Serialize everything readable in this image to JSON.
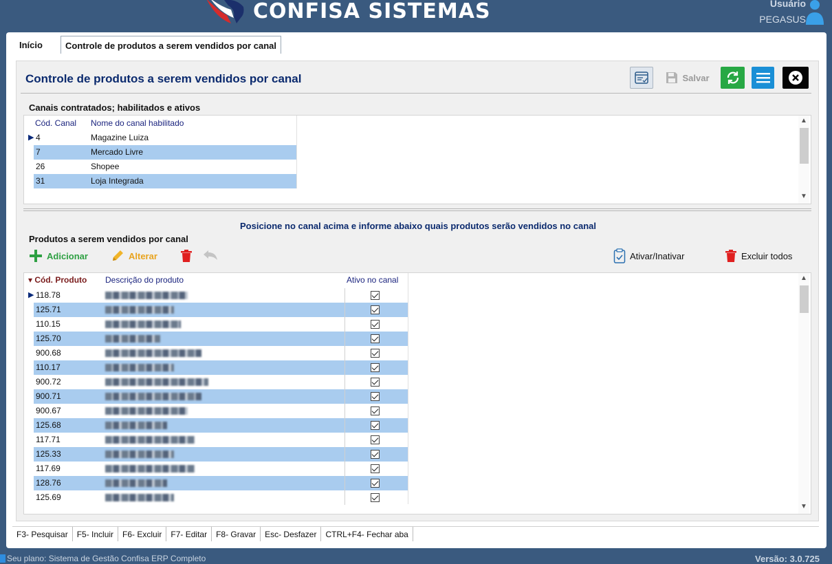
{
  "header": {
    "brand": "CONFISA SISTEMAS",
    "user_label": "Usuário",
    "user_name": "PEGASUS"
  },
  "tabs": [
    {
      "label": "Início"
    },
    {
      "label": "Controle de produtos a serem vendidos por canal"
    }
  ],
  "page": {
    "title": "Controle de produtos a serem vendidos por canal",
    "save_label": "Salvar"
  },
  "channels": {
    "group_title": "Canais contratados; habilitados e ativos",
    "columns": [
      "Cód. Canal",
      "Nome do canal habilitado"
    ],
    "rows": [
      {
        "code": "4",
        "name": "Magazine Luiza"
      },
      {
        "code": "7",
        "name": "Mercado Livre"
      },
      {
        "code": "26",
        "name": "Shopee"
      },
      {
        "code": "31",
        "name": "Loja Integrada"
      }
    ]
  },
  "hint": "Posicione no canal acima e informe abaixo quais produtos serão vendidos no canal",
  "products": {
    "group_title": "Produtos a serem vendidos por canal",
    "add_label": "Adicionar",
    "edit_label": "Alterar",
    "toggle_label": "Ativar/Inativar",
    "delete_all_label": "Excluir todos",
    "columns": [
      "Cód. Produto",
      "Descrição do produto",
      "Ativo no canal"
    ],
    "rows": [
      {
        "code": "118.78",
        "active": true
      },
      {
        "code": "125.71",
        "active": true
      },
      {
        "code": "110.15",
        "active": true
      },
      {
        "code": "125.70",
        "active": true
      },
      {
        "code": "900.68",
        "active": true
      },
      {
        "code": "110.17",
        "active": true
      },
      {
        "code": "900.72",
        "active": true
      },
      {
        "code": "900.71",
        "active": true
      },
      {
        "code": "900.67",
        "active": true
      },
      {
        "code": "125.68",
        "active": true
      },
      {
        "code": "117.71",
        "active": true
      },
      {
        "code": "125.33",
        "active": true
      },
      {
        "code": "117.69",
        "active": true
      },
      {
        "code": "128.76",
        "active": true
      },
      {
        "code": "125.69",
        "active": true
      }
    ]
  },
  "shortcuts": [
    "F3- Pesquisar",
    "F5- Incluir",
    "F6- Excluir",
    "F7- Editar",
    "F8- Gravar",
    "Esc- Desfazer",
    "CTRL+F4- Fechar aba"
  ],
  "footer": {
    "plan": "Seu plano: Sistema de Gestão Confisa ERP Completo",
    "version": "Versão: 3.0.725"
  },
  "colors": {
    "header_bg": "#3a5a7f",
    "title": "#0b2a6e",
    "row_alt": "#a9ccef",
    "refresh_btn": "#27a844",
    "menu_btn": "#1a8fd6",
    "add": "#2ea043",
    "edit": "#e8a31e",
    "delete": "#e02020"
  }
}
